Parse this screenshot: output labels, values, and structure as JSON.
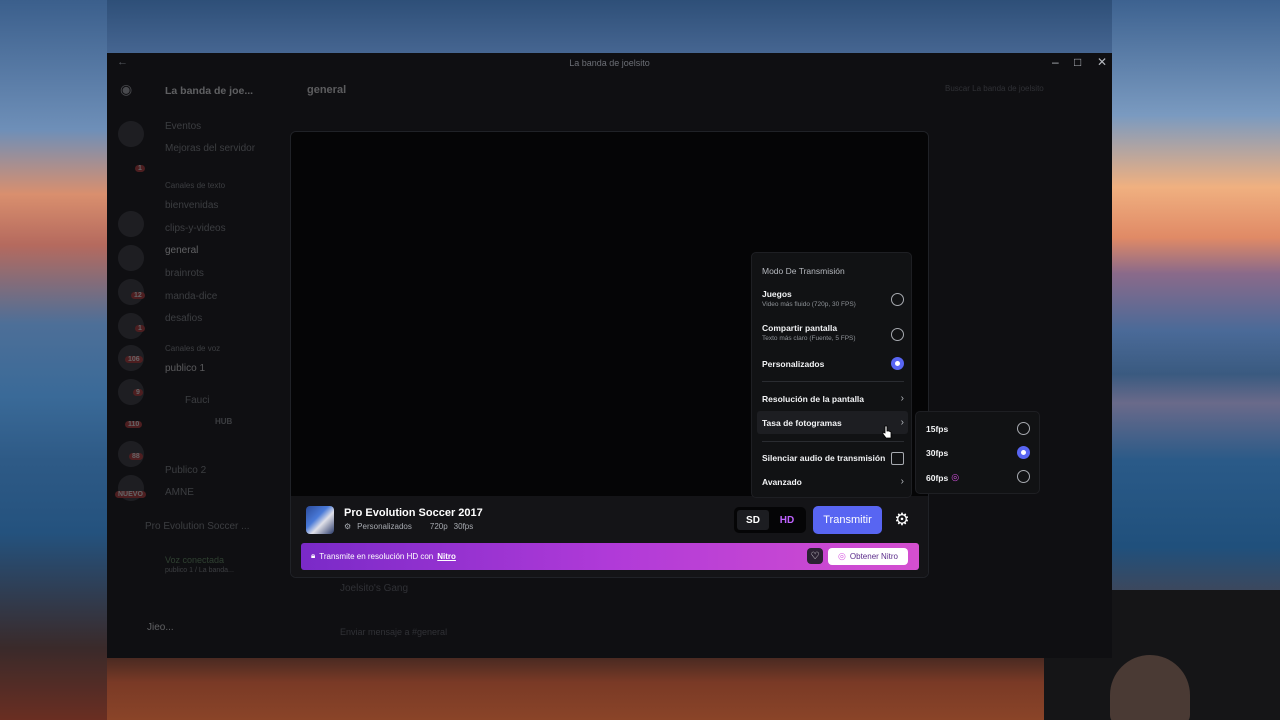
{
  "window": {
    "title": "La banda de joelsito"
  },
  "sidebar": {
    "server_name": "La banda de joe...",
    "items": [
      "Eventos",
      "Mejoras del servidor"
    ],
    "category_text": "Canales de texto",
    "text_channels": [
      "bienvenidas",
      "clips-y-videos",
      "general",
      "brainrots",
      "manda-dice",
      "desafios"
    ],
    "category_voice": "Canales de voz",
    "voice_channel": "publico 1",
    "voice_users": [
      "Fauci",
      "HUB"
    ],
    "voice_channels_more": [
      "Publico 2",
      "AMNE"
    ],
    "activity": "Pro Evolution Soccer ...",
    "voice_status": "Voz conectada",
    "voice_sub": "publico 1 / La banda...",
    "user_name": "Jieo...",
    "badges": [
      "1",
      "12",
      "1",
      "106",
      "9",
      "110",
      "88",
      "NUEVO"
    ]
  },
  "header": {
    "channel": "general",
    "search_placeholder": "Buscar La banda de joelsito"
  },
  "chat": {
    "footer_text": "Joelsito's Gang",
    "input_placeholder": "Enviar mensaje a #general"
  },
  "stream": {
    "game_title": "Pro Evolution Soccer 2017",
    "mode": "Personalizados",
    "resolution": "720p",
    "fps": "30fps",
    "sd_label": "SD",
    "hd_label": "HD",
    "go_live": "Transmitir",
    "banner_text": "Transmite en resolución HD con",
    "banner_link": "Nitro",
    "nitro_button": "Obtener Nitro"
  },
  "menu": {
    "header": "Modo De Transmisión",
    "options": [
      {
        "label": "Juegos",
        "sub": "Video más fluido (720p, 30 FPS)",
        "selected": false
      },
      {
        "label": "Compartir pantalla",
        "sub": "Texto más claro (Fuente, 5 FPS)",
        "selected": false
      },
      {
        "label": "Personalizados",
        "sub": "",
        "selected": true
      }
    ],
    "resolution": "Resolución de la pantalla",
    "framerate": "Tasa de fotogramas",
    "mute_audio": "Silenciar audio de transmisión",
    "advanced": "Avanzado"
  },
  "submenu": {
    "options": [
      {
        "label": "15fps",
        "selected": false,
        "nitro": false
      },
      {
        "label": "30fps",
        "selected": true,
        "nitro": false
      },
      {
        "label": "60fps",
        "selected": false,
        "nitro": true
      }
    ]
  },
  "colors": {
    "accent": "#5865f2",
    "nitro_start": "#7a2ac8",
    "nitro_end": "#d44fd0"
  }
}
